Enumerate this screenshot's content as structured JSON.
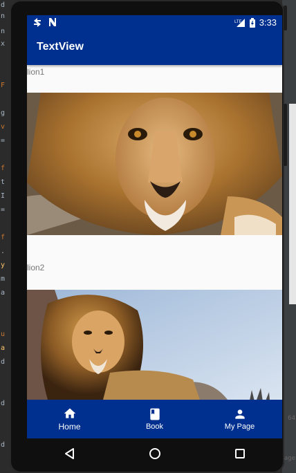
{
  "status_bar": {
    "time": "3:33",
    "network": "LTE"
  },
  "app_bar": {
    "title": "TextView"
  },
  "images": [
    {
      "label": "lion1",
      "alt": "lion1"
    },
    {
      "label": "lion2",
      "alt": "lion2"
    }
  ],
  "bottom_nav": [
    {
      "label": "Home",
      "icon": "home-icon",
      "active": true
    },
    {
      "label": "Book",
      "icon": "book-icon",
      "active": false
    },
    {
      "label": "My Page",
      "icon": "person-icon",
      "active": false
    }
  ],
  "colors": {
    "primary": "#00308f",
    "background": "#fafafa"
  }
}
